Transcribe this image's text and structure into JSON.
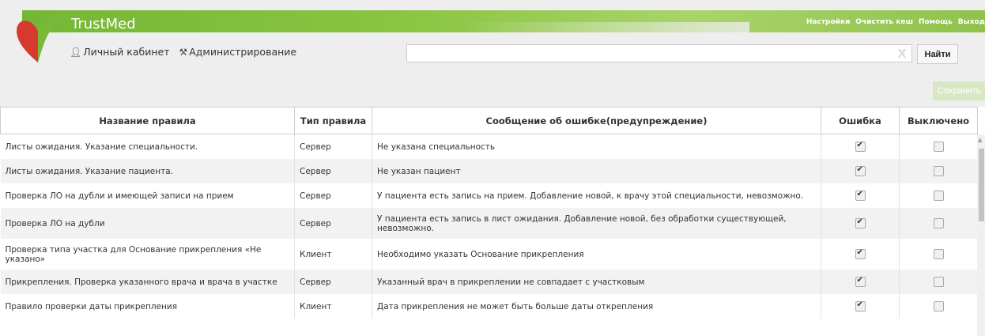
{
  "app": {
    "name": "TrustMed"
  },
  "top_links": [
    "Настройки",
    "Очистить кеш",
    "Помощь",
    "Выход"
  ],
  "user_nav": {
    "cabinet": "Личный кабинет",
    "admin": "Администрирование"
  },
  "search": {
    "value": "",
    "clear_glyph": "X",
    "button": "Найти"
  },
  "toolbar": {
    "save": "Сохранить"
  },
  "table": {
    "headers": [
      "Название правила",
      "Тип правила",
      "Сообщение об ошибке(предупреждение)",
      "Ошибка",
      "Выключено"
    ],
    "rows": [
      {
        "name": "Листы ожидания. Указание специальности.",
        "type": "Сервер",
        "message": "Не указана специальность",
        "error": true,
        "disabled": false
      },
      {
        "name": "Листы ожидания. Указание пациента.",
        "type": "Сервер",
        "message": "Не указан пациент",
        "error": true,
        "disabled": false
      },
      {
        "name": "Проверка ЛО на дубли и имеющей записи на прием",
        "type": "Сервер",
        "message": "У пациента есть запись на прием. Добавление новой, к врачу этой специальности, невозможно.",
        "error": true,
        "disabled": false
      },
      {
        "name": "Проверка ЛО на дубли",
        "type": "Сервер",
        "message": "У пациента есть запись в лист ожидания. Добавление новой, без обработки существующей, невозможно.",
        "error": true,
        "disabled": false
      },
      {
        "name": "Проверка типа участка для Основание прикрепления «Не указано»",
        "type": "Клиент",
        "message": "Необходимо указать Основание прикрепления",
        "error": true,
        "disabled": false
      },
      {
        "name": "Прикрепления. Проверка указанного врача и врача в участке",
        "type": "Сервер",
        "message": "Указанный врач в прикреплении не совпадает с участковым",
        "error": true,
        "disabled": false
      },
      {
        "name": "Правило проверки даты прикрепления",
        "type": "Клиент",
        "message": "Дата прикрепления не может быть больше даты открепления",
        "error": true,
        "disabled": false
      }
    ]
  },
  "colors": {
    "brand_green": "#8bc541",
    "header_bg": "#eeeeee",
    "logo_red": "#d63a2f",
    "logo_green": "#7ab83a"
  },
  "icons": {
    "user": "user-icon",
    "admin": "tools-icon",
    "checkbox": "checkbox"
  }
}
